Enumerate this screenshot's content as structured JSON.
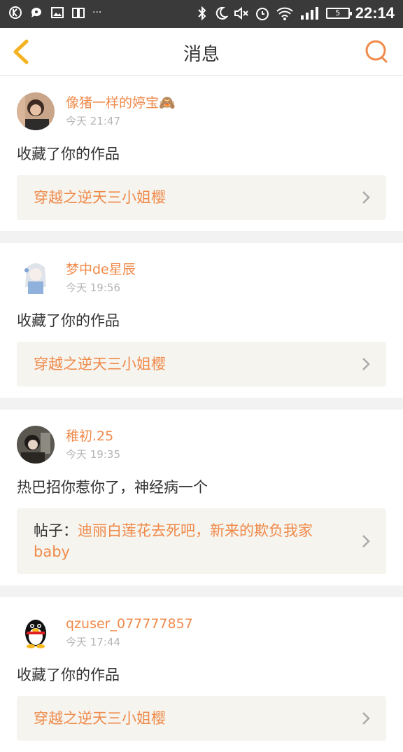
{
  "status_bar": {
    "time": "22:14",
    "battery": "5",
    "left_icons": [
      "k-badge-icon",
      "chat-bubble-icon",
      "image-icon",
      "book-icon",
      "more-dots-icon"
    ],
    "right_icons": [
      "bluetooth-icon",
      "moon-icon",
      "mute-icon",
      "alarm-icon",
      "wifi-icon",
      "signal-icon",
      "battery-icon"
    ]
  },
  "header": {
    "title": "消息",
    "back_icon": "chevron-left-icon",
    "search_icon": "search-icon"
  },
  "colors": {
    "accent": "#f08a4b",
    "back_icon": "#f5b324",
    "work_bg": "#f5f4ee",
    "divider": "#f2f2f2"
  },
  "messages": [
    {
      "username": "像猪一样的婷宝🙈",
      "time": "今天 21:47",
      "action": "收藏了你的作品",
      "prefix": "",
      "work_title": "穿越之逆天三小姐樱"
    },
    {
      "username": "梦中de星辰",
      "time": "今天 19:56",
      "action": "收藏了你的作品",
      "prefix": "",
      "work_title": "穿越之逆天三小姐樱"
    },
    {
      "username": "稚初.25",
      "time": "今天 19:35",
      "action": "热巴招你惹你了，神经病一个",
      "prefix": "帖子：",
      "work_title": "迪丽白莲花去死吧，新来的欺负我家baby"
    },
    {
      "username": "qzuser_077777857",
      "time": "今天 17:44",
      "action": "收藏了你的作品",
      "prefix": "",
      "work_title": "穿越之逆天三小姐樱"
    }
  ]
}
